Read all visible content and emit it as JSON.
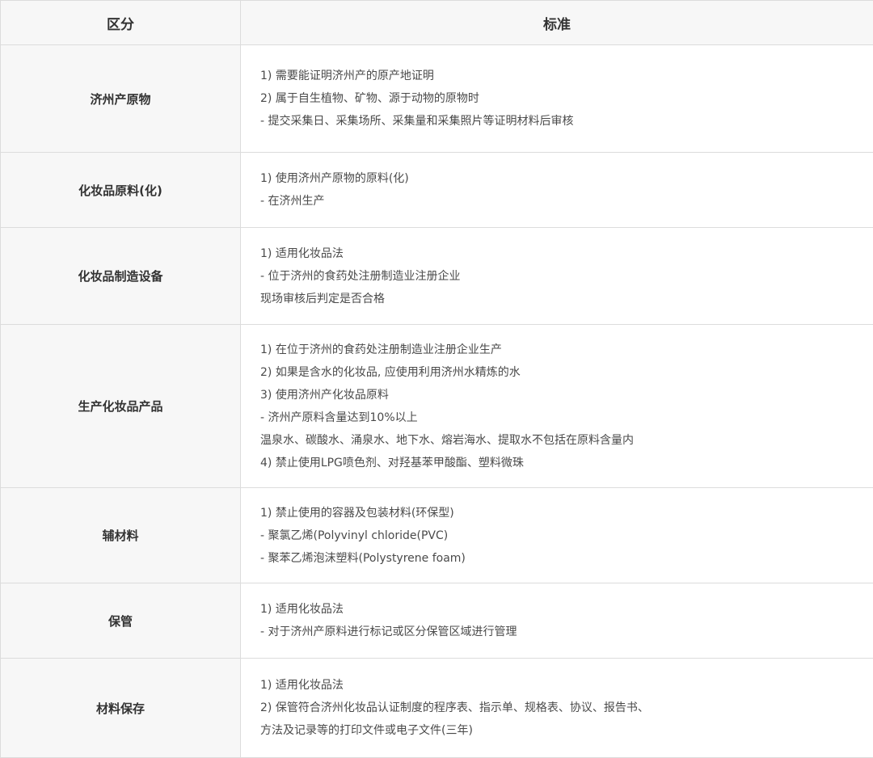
{
  "header": {
    "category": "区分",
    "standard": "标准"
  },
  "rows": [
    {
      "category": "济州产原物",
      "lines": [
        "1) 需要能证明济州产的原产地证明",
        "2) 属于自生植物、矿物、源于动物的原物时",
        "  - 提交采集日、采集场所、采集量和采集照片等证明材料后审核"
      ]
    },
    {
      "category": "化妆品原料(化)",
      "lines": [
        "1) 使用济州产原物的原料(化)",
        "  - 在济州生产"
      ]
    },
    {
      "category": "化妆品制造设备",
      "lines": [
        "1) 适用化妆品法",
        "  - 位于济州的食药处注册制造业注册企业",
        "    现场审核后判定是否合格"
      ]
    },
    {
      "category": "生产化妆品产品",
      "lines": [
        "1) 在位于济州的食药处注册制造业注册企业生产",
        "2) 如果是含水的化妆品, 应使用利用济州水精炼的水",
        "3) 使用济州产化妆品原料",
        "  - 济州产原料含量达到10%以上",
        "    温泉水、碳酸水、涌泉水、地下水、熔岩海水、提取水不包括在原料含量内",
        "4) 禁止使用LPG喷色剂、对羟基苯甲酸酯、塑料微珠"
      ]
    },
    {
      "category": "辅材料",
      "lines": [
        "1) 禁止使用的容器及包装材料(环保型)",
        "  - 聚氯乙烯(Polyvinyl chloride(PVC)",
        "  - 聚苯乙烯泡沫塑料(Polystyrene foam)"
      ]
    },
    {
      "category": "保管",
      "lines": [
        "1) 适用化妆品法",
        "  - 对于济州产原料进行标记或区分保管区域进行管理"
      ]
    },
    {
      "category": "材料保存",
      "lines": [
        "1) 适用化妆品法",
        "2) 保管符合济州化妆品认证制度的程序表、指示单、规格表、协议、报告书、",
        "    方法及记录等的打印文件或电子文件(三年)"
      ]
    }
  ]
}
